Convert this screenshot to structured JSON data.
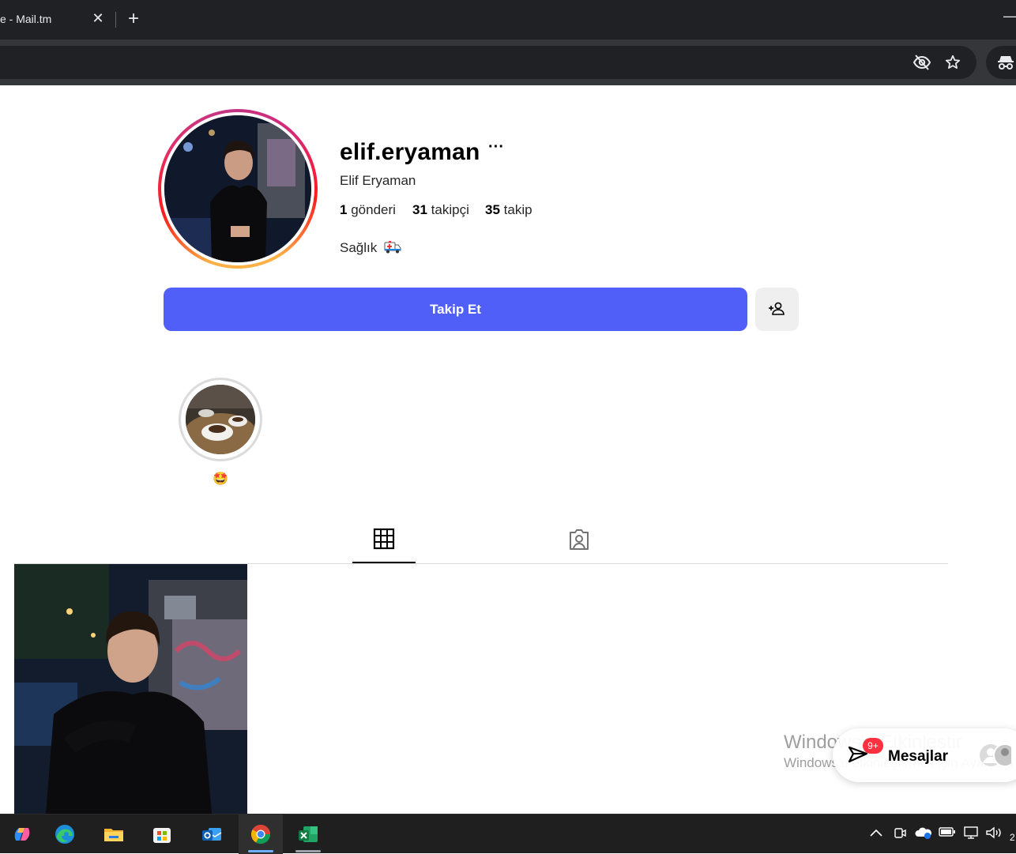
{
  "browser": {
    "tab_title": "e - Mail.tm",
    "tab_close": "✕",
    "new_tab": "+",
    "window_minimize": "—"
  },
  "profile": {
    "username": "elif.eryaman",
    "more": "···",
    "full_name": "Elif Eryaman",
    "stats": {
      "posts_count": "1",
      "posts_label": "gönderi",
      "followers_count": "31",
      "followers_label": "takipçi",
      "following_count": "35",
      "following_label": "takip"
    },
    "bio": "Sağlık",
    "bio_icon": "ambulance-icon"
  },
  "actions": {
    "follow_label": "Takip Et",
    "follow_color": "#4f5ff8"
  },
  "highlights": [
    {
      "label": "🤩"
    }
  ],
  "profile_tabs": [
    {
      "name": "posts",
      "icon": "grid-icon",
      "active": true
    },
    {
      "name": "tagged",
      "icon": "tagged-user-icon",
      "active": false
    }
  ],
  "watermark": {
    "title": "Windows'u Etkinleştir",
    "subtitle": "Windows'u etkinleştirmek için Ayarlar'a gidin."
  },
  "messages": {
    "label": "Mesajlar",
    "badge": "9+",
    "badge_color": "#ff3040"
  },
  "taskbar": {
    "apps": [
      "copilot-icon",
      "edge-icon",
      "file-explorer-icon",
      "store-icon",
      "outlook-icon",
      "chrome-icon",
      "excel-icon"
    ],
    "active_app": "chrome-icon",
    "clock_fragment": "2"
  }
}
